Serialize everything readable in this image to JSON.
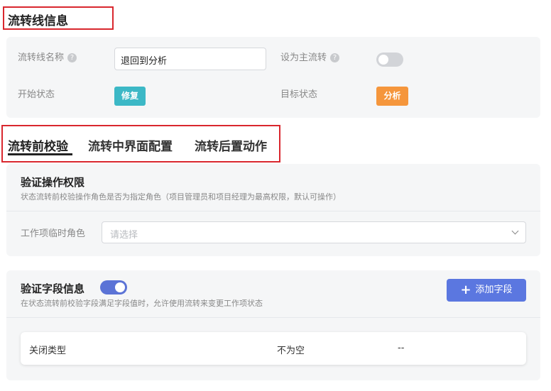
{
  "section_title": "流转线信息",
  "info": {
    "name_label": "流转线名称",
    "name_value": "退回到分析",
    "main_flow_label": "设为主流转",
    "main_flow_on": false,
    "start_label": "开始状态",
    "start_tag": "修复",
    "start_color": "#3cb8c6",
    "target_label": "目标状态",
    "target_tag": "分析",
    "target_color": "#f5963c",
    "help_glyph": "?"
  },
  "tabs": [
    {
      "label": "流转前校验",
      "active": true
    },
    {
      "label": "流转中界面配置",
      "active": false
    },
    {
      "label": "流转后置动作",
      "active": false
    }
  ],
  "permission_card": {
    "title": "验证操作权限",
    "subtitle": "状态流转前校验操作角色是否为指定角色（项目管理员和项目经理为最高权限，默认可操作）",
    "role_label": "工作项临时角色",
    "role_placeholder": "请选择"
  },
  "field_card": {
    "title": "验证字段信息",
    "enabled": true,
    "subtitle": "在状态流转前校验字段满足字段值时，允许使用流转来变更工作项状态",
    "add_button": "添加字段",
    "add_icon": "plus-icon",
    "rows": [
      {
        "field": "关闭类型",
        "condition": "不为空",
        "value": "--"
      }
    ]
  },
  "accent_color": "#5b77e0"
}
